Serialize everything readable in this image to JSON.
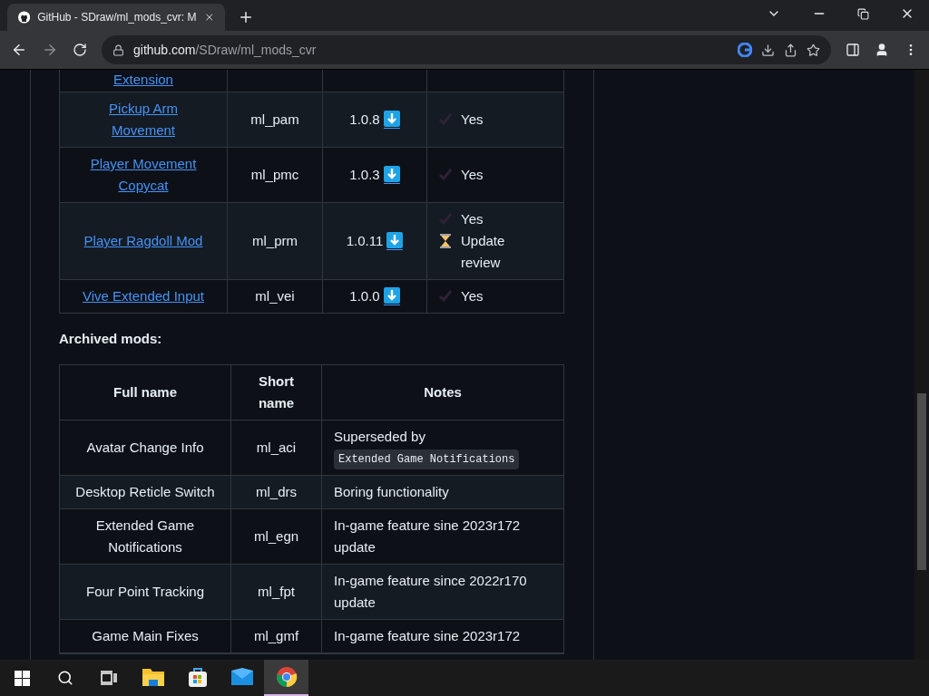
{
  "browser": {
    "tab": {
      "title": "GitHub - SDraw/ml_mods_cvr: M",
      "selected": true
    },
    "url_host": "github.com",
    "url_path": "/SDraw/ml_mods_cvr"
  },
  "mods_table": {
    "rows": [
      {
        "kind": "partial",
        "name": "Extension"
      },
      {
        "kind": "full",
        "name": "Pickup Arm Movement",
        "short": "ml_pam",
        "version": "1.0.8",
        "statuses": [
          {
            "kind": "approved",
            "label": "Yes"
          }
        ]
      },
      {
        "kind": "full",
        "name": "Player Movement Copycat",
        "short": "ml_pmc",
        "version": "1.0.3",
        "statuses": [
          {
            "kind": "approved",
            "label": "Yes"
          }
        ]
      },
      {
        "kind": "full",
        "name": "Player Ragdoll Mod",
        "short": "ml_prm",
        "version": "1.0.11",
        "statuses": [
          {
            "kind": "approved",
            "label": "Yes"
          },
          {
            "kind": "pending",
            "label": "Update review"
          }
        ]
      },
      {
        "kind": "full",
        "name": "Vive Extended Input",
        "short": "ml_vei",
        "version": "1.0.0",
        "statuses": [
          {
            "kind": "approved",
            "label": "Yes"
          }
        ]
      }
    ]
  },
  "archived": {
    "heading": "Archived mods:",
    "columns": [
      "Full name",
      "Short name",
      "Notes"
    ],
    "rows": [
      {
        "name": "Avatar Change Info",
        "short": "ml_aci",
        "notes": "Superseded by",
        "notes_code": "Extended Game Notifications"
      },
      {
        "name": "Desktop Reticle Switch",
        "short": "ml_drs",
        "notes": "Boring functionality"
      },
      {
        "name": "Extended Game Notifications",
        "short": "ml_egn",
        "notes": "In-game feature sine 2023r172 update"
      },
      {
        "name": "Four Point Tracking",
        "short": "ml_fpt",
        "notes": "In-game feature since 2022r170 update"
      },
      {
        "name": "Game Main Fixes",
        "short": "ml_gmf",
        "notes": "In-game feature sine 2023r172"
      }
    ]
  },
  "taskbar": {
    "apps": [
      {
        "kind": "files",
        "selected": false
      },
      {
        "kind": "store",
        "selected": false
      },
      {
        "kind": "mail",
        "selected": false
      },
      {
        "kind": "chrome",
        "selected": true
      }
    ]
  }
}
